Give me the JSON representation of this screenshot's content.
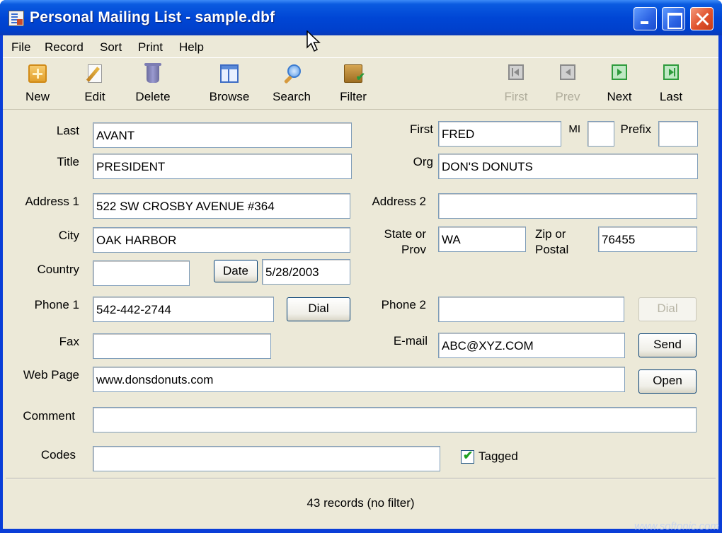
{
  "window": {
    "title": "Personal Mailing List - sample.dbf"
  },
  "menu": [
    "File",
    "Record",
    "Sort",
    "Print",
    "Help"
  ],
  "toolbar": {
    "new": "New",
    "edit": "Edit",
    "delete": "Delete",
    "browse": "Browse",
    "search": "Search",
    "filter": "Filter",
    "first": "First",
    "prev": "Prev",
    "next": "Next",
    "last": "Last"
  },
  "form": {
    "last": {
      "label": "Last",
      "value": "AVANT"
    },
    "first": {
      "label": "First",
      "value": "FRED"
    },
    "mi": {
      "label": "MI",
      "value": ""
    },
    "prefix": {
      "label": "Prefix",
      "value": ""
    },
    "title": {
      "label": "Title",
      "value": "PRESIDENT"
    },
    "org": {
      "label": "Org",
      "value": "DON'S DONUTS"
    },
    "address1": {
      "label": "Address 1",
      "value": "522 SW CROSBY AVENUE #364"
    },
    "address2": {
      "label": "Address 2",
      "value": ""
    },
    "city": {
      "label": "City",
      "value": "OAK HARBOR"
    },
    "state": {
      "label_line1": "State or",
      "label_line2": "Prov",
      "value": "WA"
    },
    "zip": {
      "label_line1": "Zip or",
      "label_line2": "Postal",
      "value": "76455"
    },
    "country": {
      "label": "Country",
      "value": ""
    },
    "date": {
      "button": "Date",
      "value": "5/28/2003"
    },
    "phone1": {
      "label": "Phone 1",
      "value": "542-442-2744",
      "button": "Dial"
    },
    "phone2": {
      "label": "Phone 2",
      "value": "",
      "button": "Dial"
    },
    "fax": {
      "label": "Fax",
      "value": ""
    },
    "email": {
      "label": "E-mail",
      "value": "ABC@XYZ.COM",
      "button": "Send"
    },
    "web": {
      "label": "Web Page",
      "value": "www.donsdonuts.com",
      "button": "Open"
    },
    "comment": {
      "label": "Comment",
      "value": ""
    },
    "codes": {
      "label": "Codes",
      "value": ""
    },
    "tagged": {
      "label": "Tagged",
      "checked": true
    }
  },
  "status": {
    "text": "43 records (no filter)"
  },
  "watermark": "www.softonic.com"
}
